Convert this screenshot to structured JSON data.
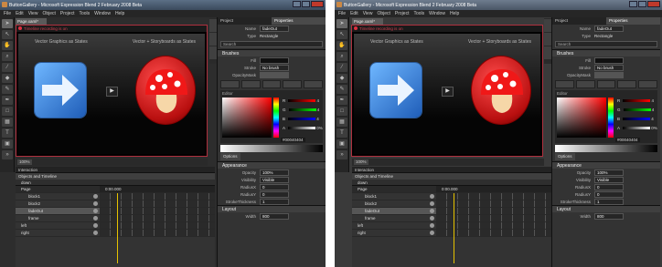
{
  "window": {
    "title": "ButtonGallery - Microsoft Expression Blend 2 February 2008 Beta",
    "title_right": "ButtonGallery - Microsoft Expression Blend 2 February 2008 Beta"
  },
  "menu": [
    "File",
    "Edit",
    "View",
    "Object",
    "Project",
    "Tools",
    "Window",
    "Help"
  ],
  "document": {
    "tab_label": "Page.xaml*",
    "recording_text": "Timeline recording is on",
    "stage_label_left": "Vector Graphics as States",
    "stage_label_right": "Vector + Storyboards as States",
    "zoom": "100%"
  },
  "interaction": {
    "panel_title": "Interaction",
    "objects_title": "Objects and Timeline",
    "state": "down",
    "root": "Page",
    "time": "0:00.000",
    "elements": [
      {
        "name": "block1",
        "indent": true,
        "selected": false
      },
      {
        "name": "block2",
        "indent": true,
        "selected": false
      },
      {
        "name": "fadeOut",
        "indent": true,
        "selected": true
      },
      {
        "name": "frame",
        "indent": true,
        "selected": false
      },
      {
        "name": "left",
        "indent": false,
        "selected": false
      },
      {
        "name": "right",
        "indent": false,
        "selected": false
      }
    ]
  },
  "properties": {
    "tabs": [
      "Project",
      "Properties"
    ],
    "name_label": "Name",
    "name_value": "fadeOut",
    "type_label": "Type",
    "type_value": "Rectangle",
    "search_placeholder": "Search",
    "brushes_title": "Brushes",
    "fill_label": "Fill",
    "stroke_label": "Stroke",
    "stroke_value": "No brush",
    "opacitymask_label": "OpacityMask",
    "editor_label": "Editor",
    "channels": [
      {
        "label": "R",
        "value": "4"
      },
      {
        "label": "G",
        "value": "4"
      },
      {
        "label": "B",
        "value": "4"
      },
      {
        "label": "A",
        "value": "0%"
      }
    ],
    "hex": "#00040404",
    "options_label": "Options",
    "appearance_title": "Appearance",
    "appearance": [
      {
        "label": "Opacity",
        "value": "100%"
      },
      {
        "label": "Visibility",
        "value": "Visible"
      },
      {
        "label": "RadiusX",
        "value": "0"
      },
      {
        "label": "RadiusY",
        "value": "0"
      },
      {
        "label": "StrokeThickness",
        "value": "1"
      }
    ],
    "layout_title": "Layout",
    "width_label": "Width",
    "width_value": "800"
  },
  "colors": {
    "record_border": "#b0303e",
    "playhead": "#e6c200",
    "selection": "#565656"
  }
}
